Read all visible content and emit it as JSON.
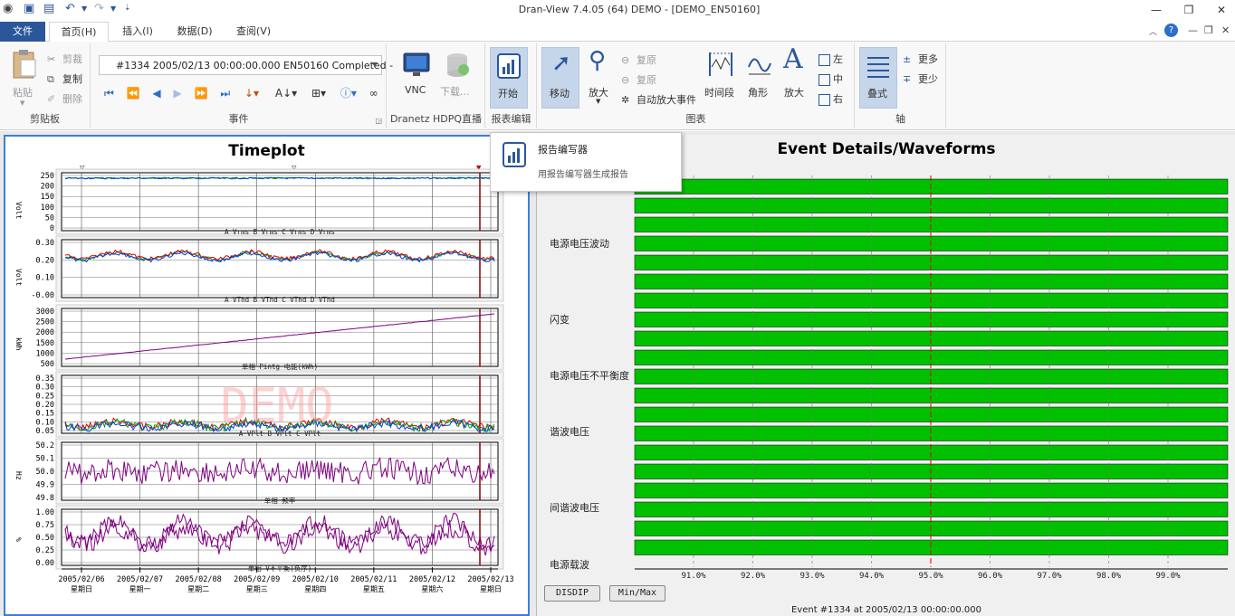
{
  "window": {
    "title": "Dran-View 7.4.05 (64) DEMO  - [DEMO_EN50160]"
  },
  "tabs": [
    {
      "label": "文件"
    },
    {
      "label": "首页(H)"
    },
    {
      "label": "插入(I)"
    },
    {
      "label": "数据(D)"
    },
    {
      "label": "查阅(V)"
    }
  ],
  "clipboard": {
    "paste": "粘贴",
    "cut": "剪裁",
    "copy": "复制",
    "delete": "删除",
    "group": "剪贴板"
  },
  "events": {
    "selected": "#1334 2005/02/13 00:00:00.000  EN50160  Completed -",
    "group": "事件"
  },
  "dranetz": {
    "vnc": "VNC",
    "download": "下载...",
    "group": "Dranetz HDPQ直播"
  },
  "report": {
    "start": "开始",
    "group": "报表编辑"
  },
  "chart": {
    "move": "移动",
    "zoom": "放大",
    "restore1": "复原",
    "restore2": "复原",
    "auto_zoom": "自动放大事件",
    "period": "时间段",
    "angle": "角形",
    "zoom2": "放大",
    "left": "左",
    "center": "中",
    "right": "右",
    "group": "图表"
  },
  "axis": {
    "stack": "叠式",
    "more": "更多",
    "less": "更少",
    "group": "轴"
  },
  "popup": {
    "title": "报告编写器",
    "desc": "用报告编写器生成报告"
  },
  "timeplot": {
    "title": "Timeplot",
    "watermark": "DEMO",
    "panels": [
      {
        "unit": "Volt",
        "ticks": [
          "250",
          "200",
          "150",
          "100",
          "50",
          "0"
        ],
        "legend": "A Vrms    B Vrms    C Vrms    D Vrms"
      },
      {
        "unit": "Volt",
        "ticks": [
          "0.30",
          "0.20",
          "0.10",
          "-0.00"
        ],
        "legend": "A VThd    B VThd    C VThd    D VThd"
      },
      {
        "unit": "kWh",
        "ticks": [
          "3000",
          "2500",
          "2000",
          "1500",
          "1000",
          "500"
        ],
        "legend": "单相 Pintg 电能(kWh)"
      },
      {
        "unit": "",
        "ticks": [
          "0.35",
          "0.30",
          "0.25",
          "0.20",
          "0.15",
          "0.10",
          "0.05"
        ],
        "legend": "A VPlt    B VPlt    C VPlt"
      },
      {
        "unit": "Hz",
        "ticks": [
          "50.2",
          "50.1",
          "50.0",
          "49.9",
          "49.8"
        ],
        "legend": "单相 频率"
      },
      {
        "unit": "%",
        "ticks": [
          "1.00",
          "0.75",
          "0.50",
          "0.25",
          "0.00"
        ],
        "legend": "单相 V不平衡(负序)"
      }
    ],
    "x_dates": [
      "2005/02/06",
      "2005/02/07",
      "2005/02/08",
      "2005/02/09",
      "2005/02/10",
      "2005/02/11",
      "2005/02/12",
      "2005/02/13"
    ],
    "x_days": [
      "星期日",
      "星期一",
      "星期二",
      "星期三",
      "星期四",
      "星期五",
      "星期六",
      "星期日"
    ]
  },
  "event_details": {
    "title": "Event Details/Waveforms",
    "categories": [
      "电源电压波动",
      "闪变",
      "电源电压不平衡度",
      "谐波电压",
      "间谐波电压",
      "电源载波"
    ],
    "x_ticks": [
      "91.0%",
      "92.0%",
      "93.0%",
      "94.0%",
      "95.0%",
      "96.0%",
      "97.0%",
      "98.0%",
      "99.0%"
    ],
    "disdip": "DISDIP",
    "minmax": "Min/Max",
    "status": "Event #1334 at 2005/02/13 00:00:00.000"
  },
  "colors": {
    "accent": "#2b579a",
    "bar_green": "#00c000",
    "series_a": "#e00000",
    "series_b": "#00a000",
    "series_c": "#0040e0",
    "single_phase": "#800080"
  }
}
